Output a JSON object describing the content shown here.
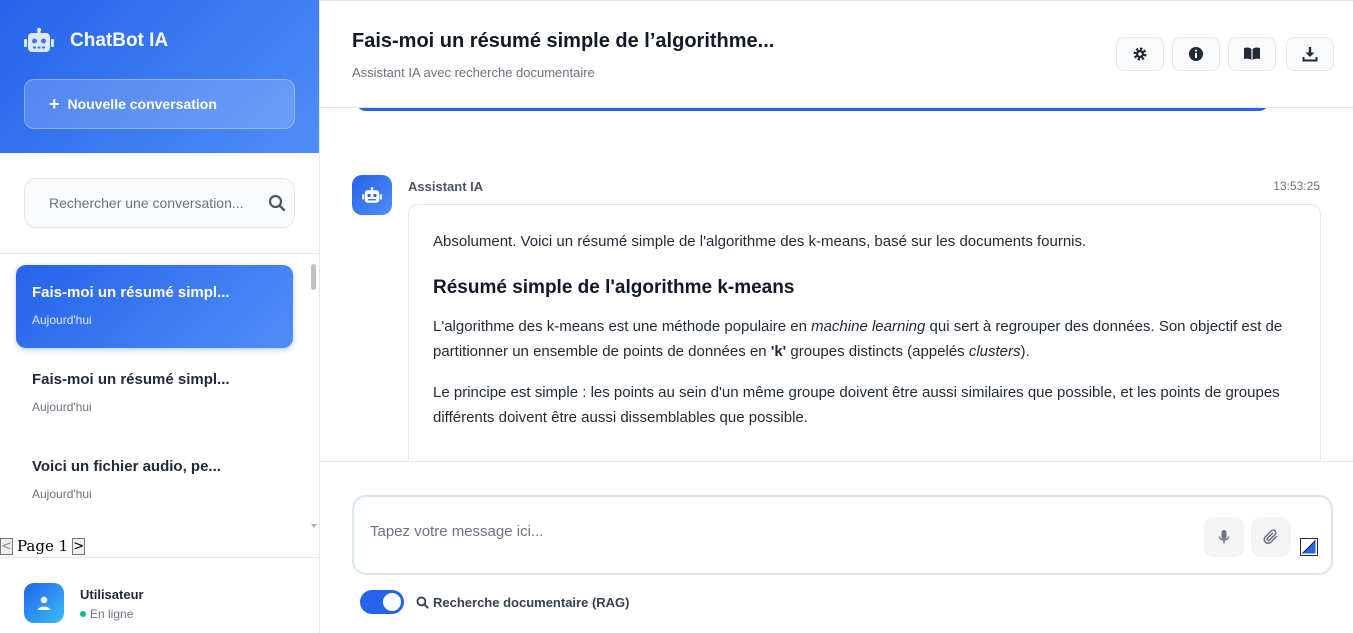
{
  "sidebar": {
    "brand": "ChatBot IA",
    "new_conversation": "Nouvelle conversation",
    "search_placeholder": "Rechercher une conversation...",
    "conversations": [
      {
        "title": "Fais-moi un résumé simpl...",
        "date": "Aujourd'hui",
        "active": true
      },
      {
        "title": "Fais-moi un résumé simpl...",
        "date": "Aujourd'hui",
        "active": false
      },
      {
        "title": "Voici un fichier audio, pe...",
        "date": "Aujourd'hui",
        "active": false
      }
    ],
    "pager": {
      "label": "Page 1",
      "prev": "<",
      "next": ">"
    },
    "user": {
      "name": "Utilisateur",
      "status": "En ligne"
    }
  },
  "header": {
    "title": "Fais-moi un résumé simple de l’algorithme...",
    "subtitle": "Assistant IA avec recherche documentaire",
    "tools": [
      "gear-icon",
      "info-icon",
      "book-icon",
      "download-icon"
    ]
  },
  "message": {
    "author": "Assistant IA",
    "time": "13:53:25",
    "intro": "Absolument. Voici un résumé simple de l'algorithme des k-means, basé sur les documents fournis.",
    "heading": "Résumé simple de l'algorithme k-means",
    "p1_a": "L'algorithme des k-means est une méthode populaire en ",
    "p1_em": "machine learning",
    "p1_b": " qui sert à regrouper des données. Son objectif est de partitionner un ensemble de points de données en ",
    "p1_strong": "'k'",
    "p1_c": " groupes distincts (appelés ",
    "p1_em2": "clusters",
    "p1_d": ").",
    "p2": "Le principe est simple : les points au sein d'un même groupe doivent être aussi similaires que possible, et les points de groupes différents doivent être aussi dissemblables que possible."
  },
  "composer": {
    "placeholder": "Tapez votre message ici...",
    "rag_label": "Recherche documentaire (RAG)",
    "rag_enabled": true
  },
  "colors": {
    "accent": "#2563eb",
    "online": "#10b981"
  }
}
